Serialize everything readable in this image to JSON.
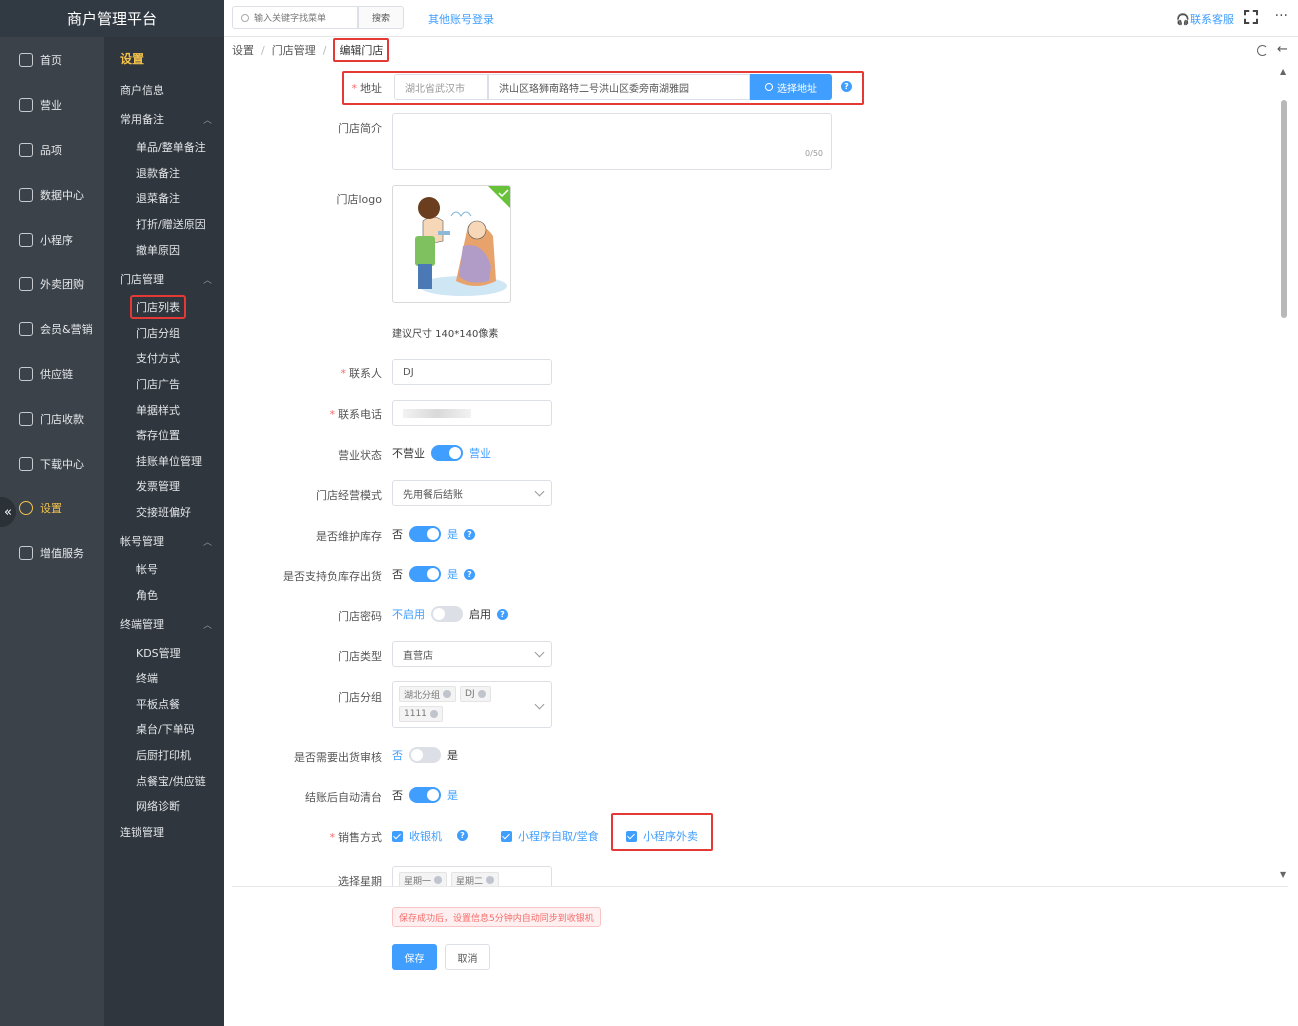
{
  "app": {
    "title": "商户管理平台"
  },
  "topbar": {
    "search_placeholder": "输入关键字找菜单",
    "search_button": "搜索",
    "other_login": "其他账号登录",
    "support": "联系客服",
    "more": "···"
  },
  "nav_primary": [
    {
      "label": "首页",
      "icon": "home-icon"
    },
    {
      "label": "营业",
      "icon": "calendar-icon"
    },
    {
      "label": "品项",
      "icon": "bag-icon"
    },
    {
      "label": "数据中心",
      "icon": "share-icon"
    },
    {
      "label": "小程序",
      "icon": "phone-icon"
    },
    {
      "label": "外卖团购",
      "icon": "bike-icon"
    },
    {
      "label": "会员&营销",
      "icon": "user-icon"
    },
    {
      "label": "供应链",
      "icon": "truck-icon"
    },
    {
      "label": "门店收款",
      "icon": "coins-icon"
    },
    {
      "label": "下载中心",
      "icon": "download-icon"
    },
    {
      "label": "设置",
      "icon": "gear-icon"
    },
    {
      "label": "增值服务",
      "icon": "alarm-icon"
    }
  ],
  "nav_secondary": {
    "title": "设置",
    "items": [
      {
        "label": "商户信息",
        "kind": "group"
      },
      {
        "label": "常用备注",
        "kind": "group",
        "caret": "︿"
      },
      {
        "label": "单品/整单备注",
        "kind": "sub"
      },
      {
        "label": "退款备注",
        "kind": "sub"
      },
      {
        "label": "退菜备注",
        "kind": "sub"
      },
      {
        "label": "打折/赠送原因",
        "kind": "sub"
      },
      {
        "label": "撤单原因",
        "kind": "sub"
      },
      {
        "label": "门店管理",
        "kind": "group",
        "caret": "︿"
      },
      {
        "label": "门店列表",
        "kind": "sub",
        "current": true
      },
      {
        "label": "门店分组",
        "kind": "sub"
      },
      {
        "label": "支付方式",
        "kind": "sub"
      },
      {
        "label": "门店广告",
        "kind": "sub"
      },
      {
        "label": "单据样式",
        "kind": "sub"
      },
      {
        "label": "寄存位置",
        "kind": "sub"
      },
      {
        "label": "挂账单位管理",
        "kind": "sub"
      },
      {
        "label": "发票管理",
        "kind": "sub"
      },
      {
        "label": "交接班偏好",
        "kind": "sub"
      },
      {
        "label": "帐号管理",
        "kind": "group",
        "caret": "︿"
      },
      {
        "label": "帐号",
        "kind": "sub"
      },
      {
        "label": "角色",
        "kind": "sub"
      },
      {
        "label": "终端管理",
        "kind": "group",
        "caret": "︿"
      },
      {
        "label": "KDS管理",
        "kind": "sub"
      },
      {
        "label": "终端",
        "kind": "sub"
      },
      {
        "label": "平板点餐",
        "kind": "sub"
      },
      {
        "label": "桌台/下单码",
        "kind": "sub"
      },
      {
        "label": "后厨打印机",
        "kind": "sub"
      },
      {
        "label": "点餐宝/供应链",
        "kind": "sub"
      },
      {
        "label": "网络诊断",
        "kind": "sub"
      },
      {
        "label": "连锁管理",
        "kind": "group"
      }
    ]
  },
  "breadcrumb": {
    "level1": "设置",
    "level2": "门店管理",
    "current": "编辑门店"
  },
  "form": {
    "address": {
      "label": "地址",
      "region": "湖北省武汉市",
      "detail": "洪山区珞狮南路特二号洪山区委旁南湖雅园",
      "button": "选择地址"
    },
    "intro": {
      "label": "门店简介",
      "counter": "0/50"
    },
    "logo": {
      "label": "门店logo",
      "hint": "建议尺寸 140*140像素"
    },
    "contact": {
      "label": "联系人",
      "value": "DJ"
    },
    "phone": {
      "label": "联系电话"
    },
    "business_status": {
      "label": "营业状态",
      "off": "不营业",
      "on": "营业"
    },
    "mode": {
      "label": "门店经营模式",
      "value": "先用餐后结账"
    },
    "stock": {
      "label": "是否维护库存",
      "off": "否",
      "on": "是"
    },
    "negative_stock": {
      "label": "是否支持负库存出货",
      "off": "否",
      "on": "是"
    },
    "password": {
      "label": "门店密码",
      "off": "不启用",
      "on": "启用"
    },
    "store_type": {
      "label": "门店类型",
      "value": "直营店"
    },
    "store_group": {
      "label": "门店分组",
      "tags": [
        "湖北分组",
        "DJ",
        "1111"
      ]
    },
    "audit": {
      "label": "是否需要出货审核",
      "off": "否",
      "on": "是"
    },
    "auto_clear": {
      "label": "结账后自动清台",
      "off": "否",
      "on": "是"
    },
    "sales": {
      "label": "销售方式",
      "options": [
        "收银机",
        "小程序自取/堂食",
        "小程序外卖"
      ]
    },
    "weekday": {
      "label": "选择星期",
      "tags": [
        "星期一",
        "星期二"
      ]
    }
  },
  "footer": {
    "notice": "保存成功后，设置信息5分钟内自动同步到收银机",
    "save": "保存",
    "cancel": "取消"
  }
}
